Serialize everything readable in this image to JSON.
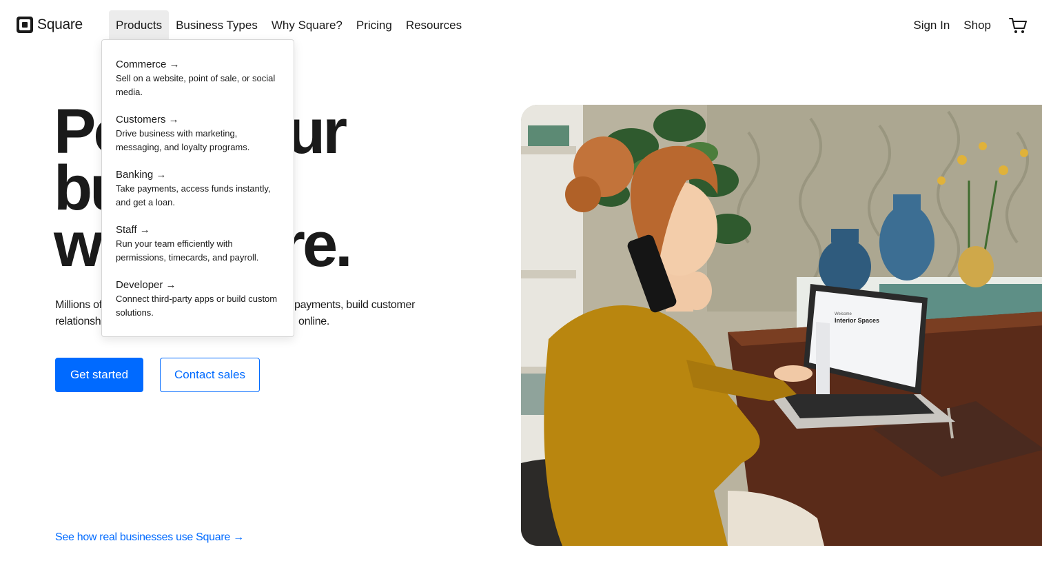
{
  "brand": {
    "name": "Square"
  },
  "nav": {
    "items": [
      {
        "label": "Products",
        "active": true
      },
      {
        "label": "Business Types"
      },
      {
        "label": "Why Square?"
      },
      {
        "label": "Pricing"
      },
      {
        "label": "Resources"
      }
    ],
    "right": {
      "sign_in": "Sign In",
      "shop": "Shop",
      "cart_icon": "cart-icon"
    }
  },
  "products_menu": {
    "items": [
      {
        "title": "Commerce →",
        "desc": "Sell on a website, point of sale, or social media."
      },
      {
        "title": "Customers →",
        "desc": "Drive business with marketing, messaging, and loyalty programs."
      },
      {
        "title": "Banking →",
        "desc": "Take payments, access funds instantly, and get a loan."
      },
      {
        "title": "Staff →",
        "desc": "Run your team efficiently with permissions, timecards, and payroll."
      },
      {
        "title": "Developer →",
        "desc": "Connect third-party apps or build custom solutions."
      }
    ]
  },
  "hero": {
    "title_visible": [
      "Po",
      "ur",
      "bu",
      "w",
      "are."
    ],
    "subtitle_visible": [
      "Millions of",
      "payments, build customer",
      "relationsh",
      "online."
    ],
    "primary_cta": "Get started",
    "secondary_cta": "Contact sales",
    "link": "See how real businesses use Square →"
  },
  "laptop_screen": {
    "heading_small": "Welcome",
    "heading": "Interior Spaces"
  },
  "colors": {
    "accent": "#006aff",
    "text": "#1a1a1a",
    "menu_active_bg": "#ececec"
  }
}
